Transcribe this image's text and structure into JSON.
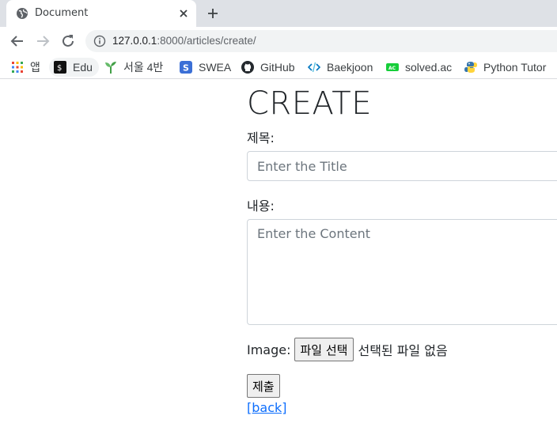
{
  "browser": {
    "tab": {
      "title": "Document",
      "favicon": "globe-icon"
    },
    "new_tab_icon": "plus-icon",
    "url": {
      "host": "127.0.0.1",
      "rest": ":8000/articles/create/"
    },
    "bookmarks": [
      {
        "label": "앱",
        "icon": "apps-grid-icon"
      },
      {
        "label": "Edu",
        "icon": "edu-icon"
      },
      {
        "label": "서울 4반",
        "icon": "sprout-icon"
      },
      {
        "label": "SWEA",
        "icon": "swea-icon"
      },
      {
        "label": "GitHub",
        "icon": "github-icon"
      },
      {
        "label": "Baekjoon",
        "icon": "code-icon"
      },
      {
        "label": "solved.ac",
        "icon": "solvedac-icon"
      },
      {
        "label": "Python Tutor",
        "icon": "python-icon"
      }
    ]
  },
  "page": {
    "heading": "CREATE",
    "title_label": "제목:",
    "title_placeholder": "Enter the Title",
    "content_label": "내용:",
    "content_placeholder": "Enter the Content",
    "image_label": "Image:",
    "file_button": "파일 선택",
    "file_status": "선택된 파일 없음",
    "submit": "제출",
    "back": "[back]"
  }
}
